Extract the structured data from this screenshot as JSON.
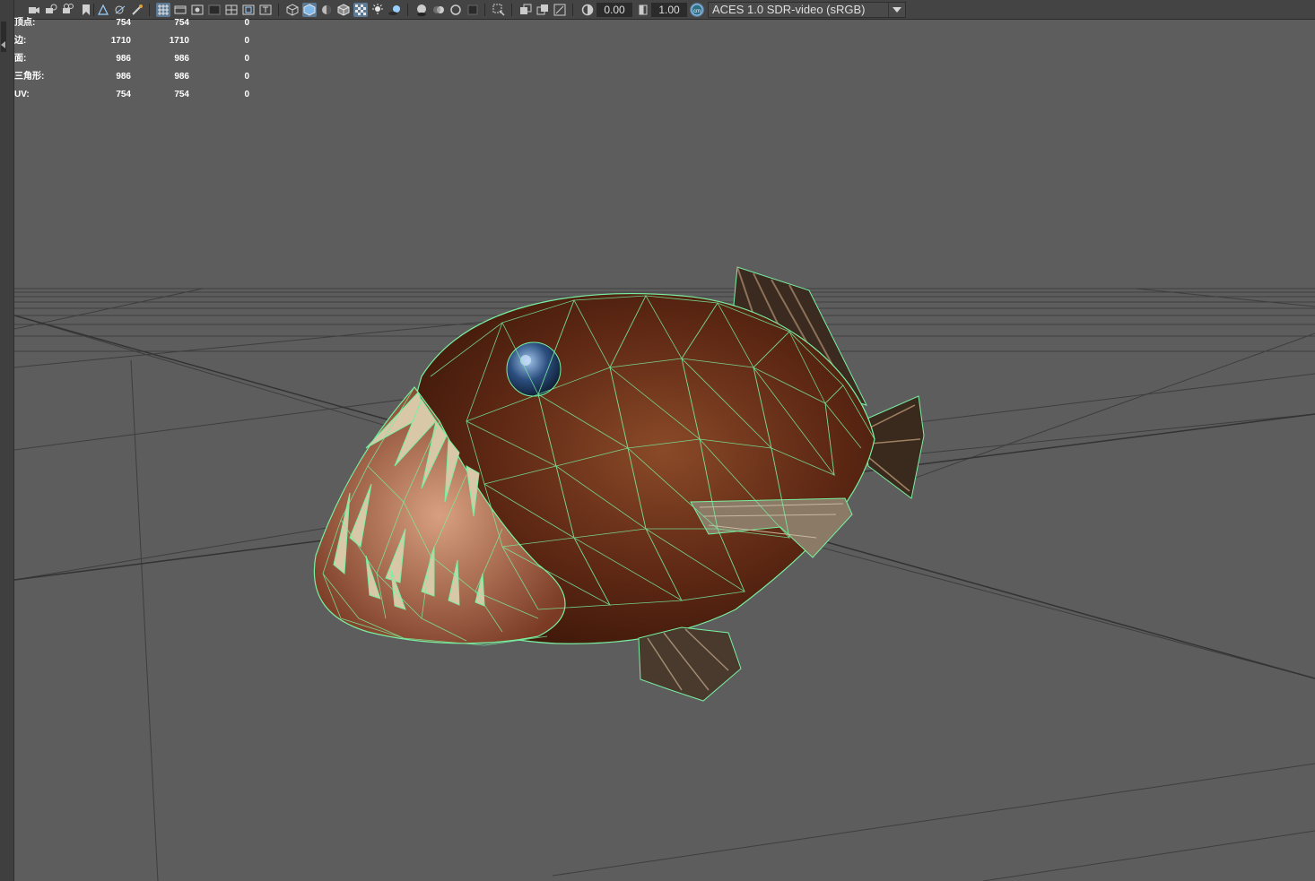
{
  "toolbar": {
    "exposure_value": "0.00",
    "gamma_value": "1.00",
    "color_space": "ACES 1.0 SDR-video (sRGB)",
    "icons": [
      "camera-icon",
      "camera-attributes-icon",
      "bookmark-icon",
      "image-plane-icon",
      "grid-icon",
      "film-gate-icon",
      "resolution-gate-icon",
      "gate-mask-icon",
      "field-chart-icon",
      "safe-action-icon",
      "safe-title-icon",
      "wireframe-icon",
      "smooth-shade-icon",
      "default-material-icon",
      "wireframe-on-shaded-icon",
      "xray-icon",
      "use-all-lights-icon",
      "shadows-icon",
      "screen-space-ao-icon",
      "motion-blur-icon",
      "multisample-aa-icon",
      "depth-of-field-icon",
      "isolate-select-icon",
      "xray-joints-icon",
      "xray-active-icon",
      "backface-cull-icon",
      "exposure-icon",
      "gamma-icon",
      "color-management-icon"
    ]
  },
  "hud": {
    "rows": [
      {
        "label": "顶点:",
        "v1": "754",
        "v2": "754",
        "v3": "0"
      },
      {
        "label": "边:",
        "v1": "1710",
        "v2": "1710",
        "v3": "0"
      },
      {
        "label": "面:",
        "v1": "986",
        "v2": "986",
        "v3": "0"
      },
      {
        "label": "三角形:",
        "v1": "986",
        "v2": "986",
        "v3": "0"
      },
      {
        "label": "UV:",
        "v1": "754",
        "v2": "754",
        "v3": "0"
      }
    ]
  },
  "colors": {
    "viewport_bg": "#5d5d5d",
    "grid_line": "#3a3a3a",
    "wireframe": "#78f0a0",
    "fish_body": "#6b2e15",
    "active_icon": "#5d7a95"
  }
}
